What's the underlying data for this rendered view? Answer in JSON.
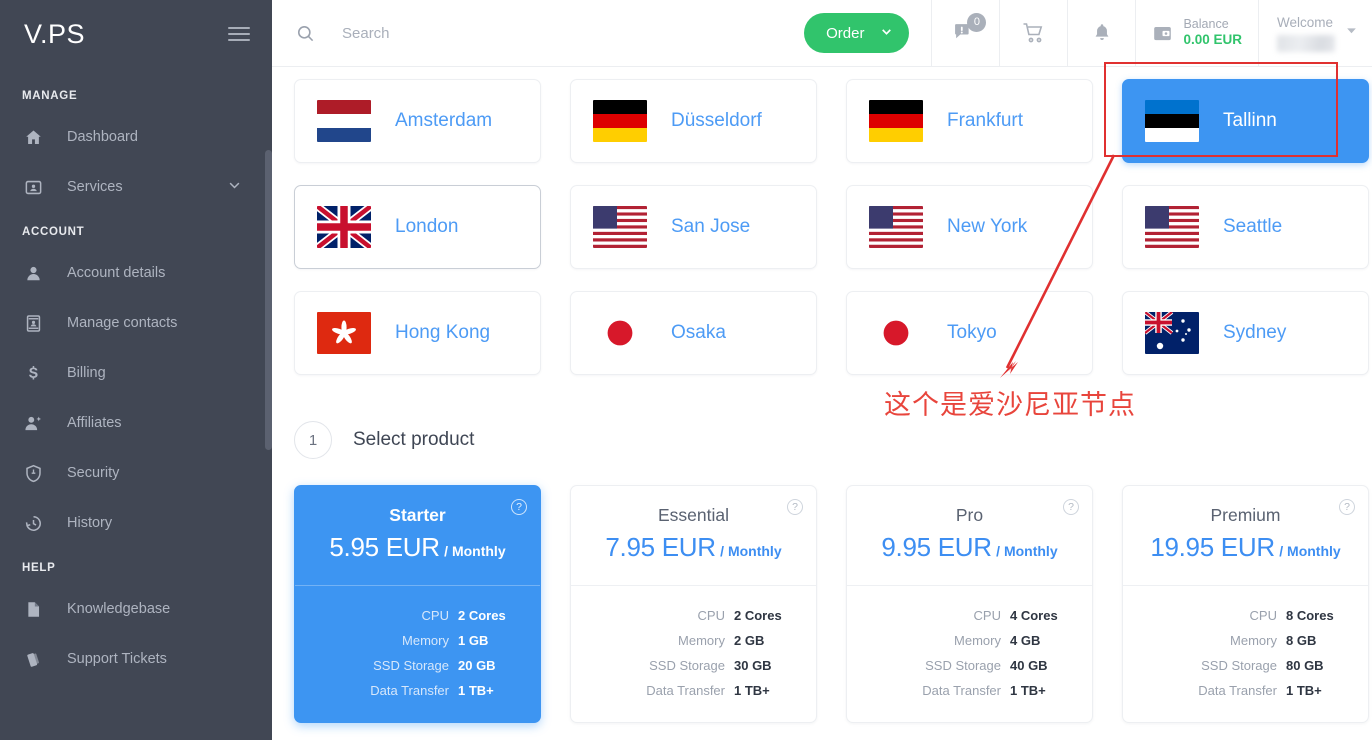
{
  "sidebar": {
    "brand": "V.PS",
    "menu_icon": "hamburger-icon",
    "sections": [
      {
        "title": "MANAGE",
        "items": [
          {
            "label": "Dashboard",
            "icon": "home-icon",
            "chevron": false
          },
          {
            "label": "Services",
            "icon": "services-card-icon",
            "chevron": true
          }
        ]
      },
      {
        "title": "ACCOUNT",
        "items": [
          {
            "label": "Account details",
            "icon": "person-icon",
            "chevron": false
          },
          {
            "label": "Manage contacts",
            "icon": "contact-card-icon",
            "chevron": false
          },
          {
            "label": "Billing",
            "icon": "dollar-icon",
            "chevron": false
          },
          {
            "label": "Affiliates",
            "icon": "person-add-icon",
            "chevron": false
          },
          {
            "label": "Security",
            "icon": "shield-icon",
            "chevron": false
          },
          {
            "label": "History",
            "icon": "history-clock-icon",
            "chevron": false
          }
        ]
      },
      {
        "title": "HELP",
        "items": [
          {
            "label": "Knowledgebase",
            "icon": "document-icon",
            "chevron": false
          },
          {
            "label": "Support Tickets",
            "icon": "tickets-icon",
            "chevron": false
          }
        ]
      }
    ]
  },
  "topbar": {
    "search": {
      "value": "",
      "placeholder": "Search",
      "icon": "search-icon"
    },
    "order_button": {
      "label": "Order",
      "icon": "chevron-down-icon",
      "color": "#31c46c"
    },
    "messages": {
      "icon": "message-alert-icon",
      "badge": "0"
    },
    "cart": {
      "icon": "shopping-cart-icon"
    },
    "notifications": {
      "icon": "bell-icon"
    },
    "balance": {
      "icon": "wallet-icon",
      "label": "Balance",
      "value": "0.00 EUR",
      "color": "#31c46c"
    },
    "account": {
      "greeting": "Welcome",
      "username_redacted": true,
      "icon": "chevron-down-icon"
    }
  },
  "locations": [
    {
      "name": "Amsterdam",
      "flag": "nl",
      "selected": false,
      "hovered": false
    },
    {
      "name": "Düsseldorf",
      "flag": "de",
      "selected": false,
      "hovered": false
    },
    {
      "name": "Frankfurt",
      "flag": "de",
      "selected": false,
      "hovered": false
    },
    {
      "name": "Tallinn",
      "flag": "ee",
      "selected": true,
      "hovered": false
    },
    {
      "name": "London",
      "flag": "gb",
      "selected": false,
      "hovered": true
    },
    {
      "name": "San Jose",
      "flag": "us",
      "selected": false,
      "hovered": false
    },
    {
      "name": "New York",
      "flag": "us",
      "selected": false,
      "hovered": false
    },
    {
      "name": "Seattle",
      "flag": "us",
      "selected": false,
      "hovered": false
    },
    {
      "name": "Hong Kong",
      "flag": "hk",
      "selected": false,
      "hovered": false
    },
    {
      "name": "Osaka",
      "flag": "jp",
      "selected": false,
      "hovered": false
    },
    {
      "name": "Tokyo",
      "flag": "jp",
      "selected": false,
      "hovered": false
    },
    {
      "name": "Sydney",
      "flag": "au",
      "selected": false,
      "hovered": false
    }
  ],
  "step": {
    "number": "1",
    "title": "Select product"
  },
  "spec_labels": {
    "cpu": "CPU",
    "memory": "Memory",
    "storage": "SSD Storage",
    "transfer": "Data Transfer"
  },
  "products": [
    {
      "name": "Starter",
      "price": "5.95 EUR",
      "period": "/ Monthly",
      "selected": true,
      "help": "?",
      "cpu": "2 Cores",
      "memory": "1 GB",
      "storage": "20 GB",
      "transfer": "1 TB+"
    },
    {
      "name": "Essential",
      "price": "7.95 EUR",
      "period": "/ Monthly",
      "selected": false,
      "help": "?",
      "cpu": "2 Cores",
      "memory": "2 GB",
      "storage": "30 GB",
      "transfer": "1 TB+"
    },
    {
      "name": "Pro",
      "price": "9.95 EUR",
      "period": "/ Monthly",
      "selected": false,
      "help": "?",
      "cpu": "4 Cores",
      "memory": "4 GB",
      "storage": "40 GB",
      "transfer": "1 TB+"
    },
    {
      "name": "Premium",
      "price": "19.95 EUR",
      "period": "/ Monthly",
      "selected": false,
      "help": "?",
      "cpu": "8 Cores",
      "memory": "8 GB",
      "storage": "80 GB",
      "transfer": "1 TB+"
    }
  ],
  "annotation": {
    "text": "这个是爱沙尼亚节点",
    "color": "#e8453c",
    "highlight_target": "Tallinn"
  }
}
